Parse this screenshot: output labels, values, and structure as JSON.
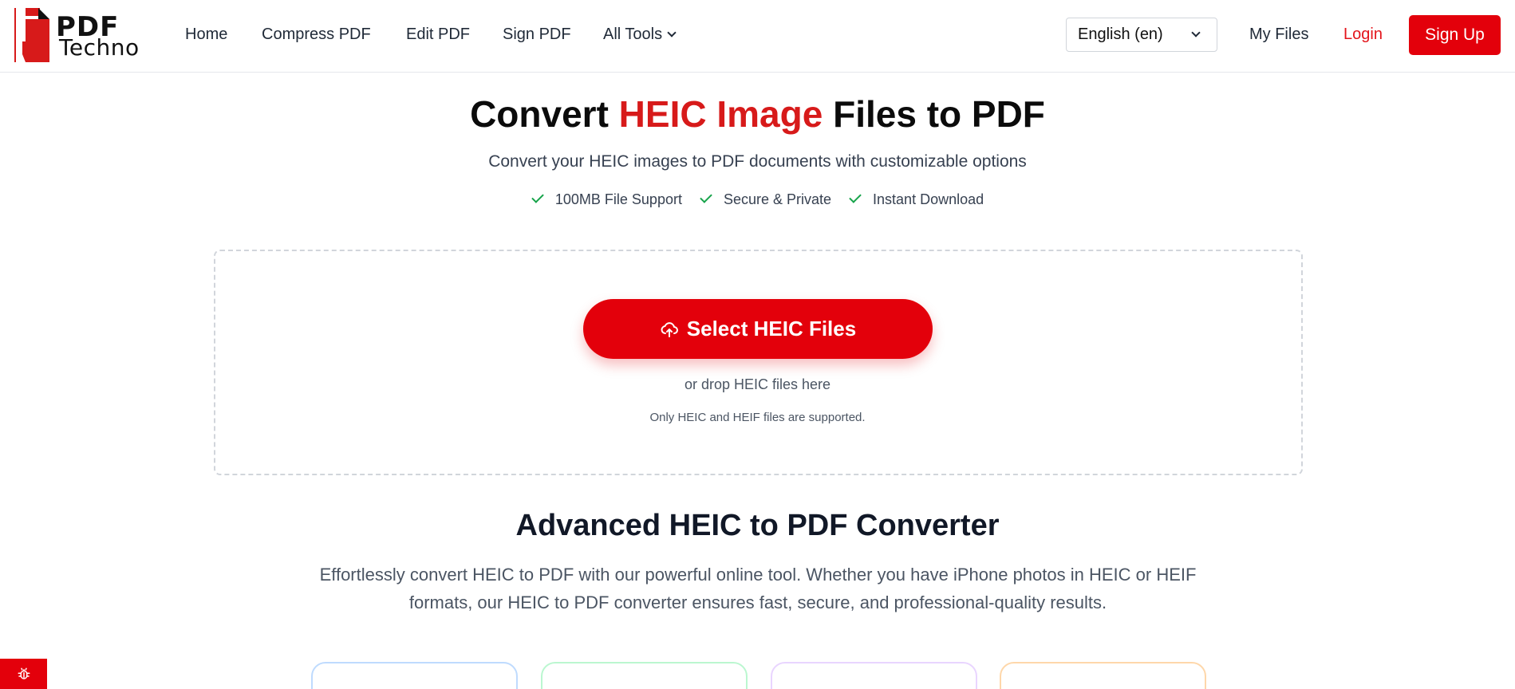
{
  "header": {
    "logo": {
      "line1": "PDF",
      "line2": "Techno"
    },
    "nav": [
      {
        "label": "Home"
      },
      {
        "label": "Compress PDF"
      },
      {
        "label": "Edit PDF"
      },
      {
        "label": "Sign PDF"
      },
      {
        "label": "All Tools"
      }
    ],
    "language": "English (en)",
    "my_files": "My Files",
    "login": "Login",
    "signup": "Sign Up"
  },
  "hero": {
    "title_pre": "Convert ",
    "title_accent": "HEIC Image",
    "title_post": " Files to PDF",
    "subtitle": "Convert your HEIC images to PDF documents with customizable options",
    "features": [
      "100MB File Support",
      "Secure & Private",
      "Instant Download"
    ]
  },
  "upload": {
    "button_label": "Select HEIC Files",
    "drop_hint": "or drop HEIC files here",
    "note": "Only HEIC and HEIF files are supported."
  },
  "section": {
    "title": "Advanced HEIC to PDF Converter",
    "description": "Effortlessly convert HEIC to PDF with our powerful online tool. Whether you have iPhone photos in HEIC or HEIF formats, our HEIC to PDF converter ensures fast, secure, and professional-quality results."
  },
  "colors": {
    "accent": "#e3000b",
    "check": "#16a34a",
    "card_borders": [
      "#bfdbfe",
      "#bbf7d0",
      "#e9d5ff",
      "#fed7aa"
    ]
  },
  "icons": {
    "upload": "cloud-upload-icon",
    "check": "check-icon",
    "chevron": "chevron-down-icon",
    "bug": "bug-icon"
  }
}
